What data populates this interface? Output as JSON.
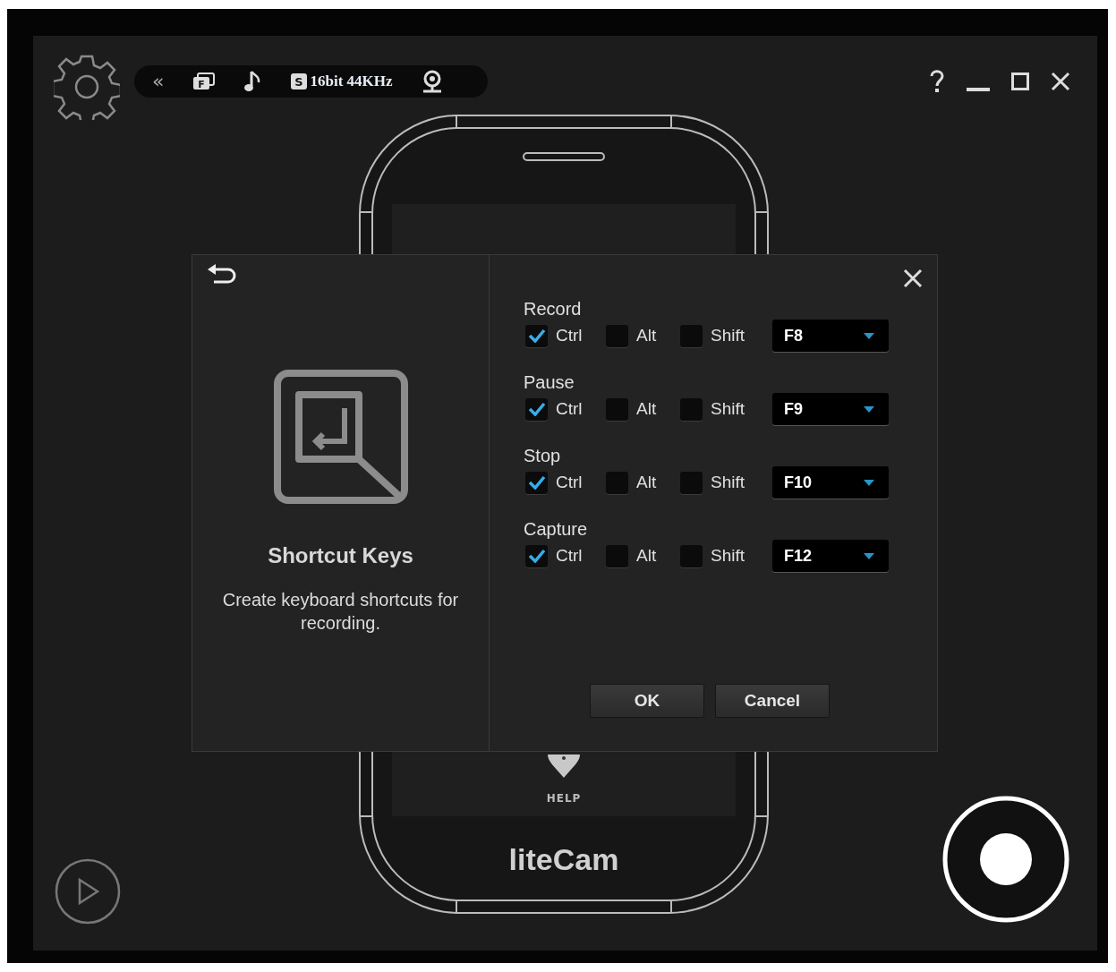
{
  "toolbar": {
    "collapse_glyph": "«",
    "window_badge": "F",
    "channel_badge": "S",
    "audio_format": "16bit 44KHz"
  },
  "phone": {
    "help_label": "HELP",
    "brand": "liteCam"
  },
  "dialog": {
    "title": "Shortcut Keys",
    "description": "Create keyboard shortcuts for recording.",
    "shortcuts": [
      {
        "action": "Record",
        "modifiers": [
          {
            "label": "Ctrl",
            "checked": true
          },
          {
            "label": "Alt",
            "checked": false
          },
          {
            "label": "Shift",
            "checked": false
          }
        ],
        "key": "F8"
      },
      {
        "action": "Pause",
        "modifiers": [
          {
            "label": "Ctrl",
            "checked": true
          },
          {
            "label": "Alt",
            "checked": false
          },
          {
            "label": "Shift",
            "checked": false
          }
        ],
        "key": "F9"
      },
      {
        "action": "Stop",
        "modifiers": [
          {
            "label": "Ctrl",
            "checked": true
          },
          {
            "label": "Alt",
            "checked": false
          },
          {
            "label": "Shift",
            "checked": false
          }
        ],
        "key": "F10"
      },
      {
        "action": "Capture",
        "modifiers": [
          {
            "label": "Ctrl",
            "checked": true
          },
          {
            "label": "Alt",
            "checked": false
          },
          {
            "label": "Shift",
            "checked": false
          }
        ],
        "key": "F12"
      }
    ],
    "buttons": [
      "OK",
      "Cancel"
    ]
  }
}
